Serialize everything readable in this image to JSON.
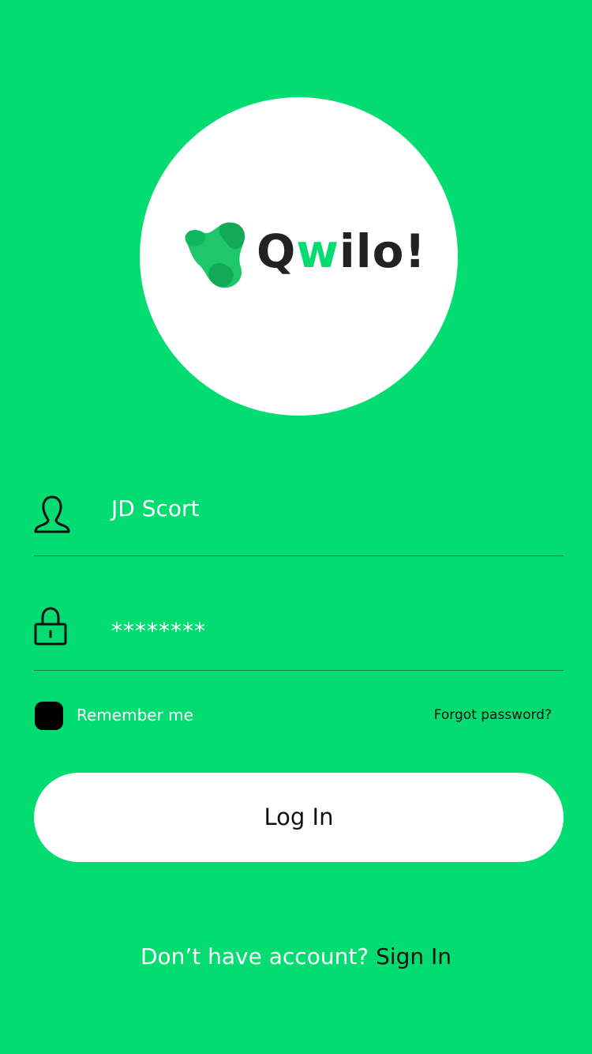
{
  "brand": {
    "name_prefix": "Q",
    "name_accent": "w",
    "name_suffix": "ilo!",
    "accent_color": "#03dc70",
    "text_color": "#222222",
    "logo_icon": "blob-logo-icon"
  },
  "background_color": "#03dc70",
  "form": {
    "username": {
      "icon": "user-icon",
      "value": "JD Scort"
    },
    "password": {
      "icon": "lock-icon",
      "value": "********"
    },
    "remember_me": {
      "label": "Remember me",
      "checked": true
    },
    "forgot_password_label": "Forgot password?",
    "login_button_label": "Log In"
  },
  "footer": {
    "prompt": "Don’t have account?",
    "sign_in_label": "Sign In"
  }
}
